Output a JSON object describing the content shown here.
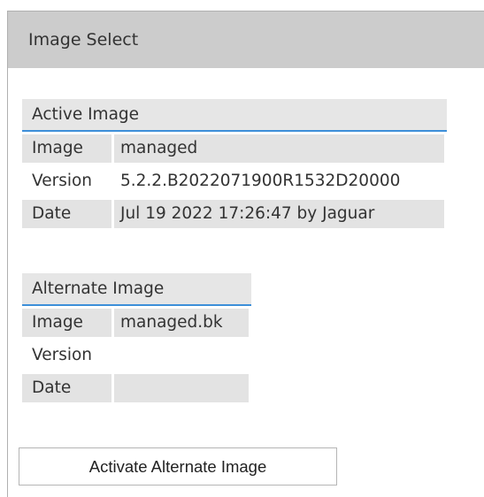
{
  "header": {
    "title": "Image Select"
  },
  "active_image": {
    "title": "Active Image",
    "rows": [
      {
        "label": "Image",
        "value": "managed"
      },
      {
        "label": "Version",
        "value": "5.2.2.B2022071900R1532D20000"
      },
      {
        "label": "Date",
        "value": "Jul 19 2022 17:26:47 by Jaguar"
      }
    ]
  },
  "alternate_image": {
    "title": "Alternate Image",
    "rows": [
      {
        "label": "Image",
        "value": "managed.bk"
      },
      {
        "label": "Version",
        "value": ""
      },
      {
        "label": "Date",
        "value": ""
      }
    ]
  },
  "actions": {
    "activate_label": "Activate Alternate Image"
  },
  "colors": {
    "header_bg": "#cccccc",
    "row_shade": "#e3e3e3",
    "title_underline": "#3d8fd9"
  }
}
